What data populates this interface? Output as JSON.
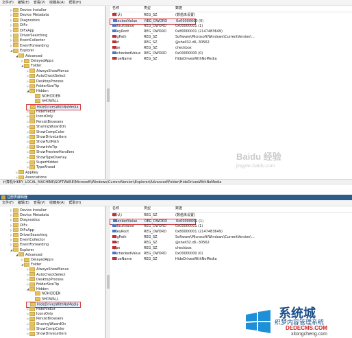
{
  "colors": {
    "highlight_border": "#d23b3b",
    "titlebar": "#2b5c8a",
    "folder": "#e6c25a"
  },
  "panel1": {
    "menu": [
      "文件(F)",
      "编辑(E)",
      "查看(V)",
      "收藏夹(A)",
      "帮助(H)"
    ],
    "tree": [
      {
        "label": "Device Installer",
        "indent": 1,
        "arrow": "▷"
      },
      {
        "label": "Device Metadata",
        "indent": 1,
        "arrow": "▷"
      },
      {
        "label": "Diagnostics",
        "indent": 1,
        "arrow": "▷"
      },
      {
        "label": "DIFx",
        "indent": 1,
        "arrow": "▷"
      },
      {
        "label": "DIFxApp",
        "indent": 1,
        "arrow": "▷"
      },
      {
        "label": "DriverSearching",
        "indent": 1,
        "arrow": "▷"
      },
      {
        "label": "EventCollector",
        "indent": 1,
        "arrow": "▷"
      },
      {
        "label": "EventForwarding",
        "indent": 1,
        "arrow": "▷"
      },
      {
        "label": "Explorer",
        "indent": 1,
        "arrow": "◢"
      },
      {
        "label": "Advanced",
        "indent": 2,
        "arrow": "◢"
      },
      {
        "label": "DelayedApps",
        "indent": 3,
        "arrow": "▷"
      },
      {
        "label": "Folder",
        "indent": 3,
        "arrow": "◢"
      },
      {
        "label": "AlwaysShowMenus",
        "indent": 4,
        "arrow": "▷"
      },
      {
        "label": "AutoCheckSelect",
        "indent": 4,
        "arrow": "▷"
      },
      {
        "label": "DesktopProcess",
        "indent": 4,
        "arrow": "▷"
      },
      {
        "label": "FolderSizeTip",
        "indent": 4,
        "arrow": "▷"
      },
      {
        "label": "Hidden",
        "indent": 4,
        "arrow": "◢"
      },
      {
        "label": "NOHIDDEN",
        "indent": 5,
        "arrow": ""
      },
      {
        "label": "SHOWALL",
        "indent": 5,
        "arrow": ""
      },
      {
        "label": "HideDrivesWithNoMedia",
        "indent": 4,
        "arrow": "",
        "sel": true
      },
      {
        "label": "HideFileExt",
        "indent": 4,
        "arrow": "▷"
      },
      {
        "label": "IconsOnly",
        "indent": 4,
        "arrow": "▷"
      },
      {
        "label": "PersistBrowsers",
        "indent": 4,
        "arrow": "▷"
      },
      {
        "label": "SharingWizardOn",
        "indent": 4,
        "arrow": "▷"
      },
      {
        "label": "ShowCompColor",
        "indent": 4,
        "arrow": "▷"
      },
      {
        "label": "ShowDriveLetters",
        "indent": 4,
        "arrow": "▷"
      },
      {
        "label": "ShowFullPath",
        "indent": 4,
        "arrow": "▷"
      },
      {
        "label": "ShowInfoTip",
        "indent": 4,
        "arrow": "▷"
      },
      {
        "label": "ShowPreviewHandlers",
        "indent": 4,
        "arrow": "▷"
      },
      {
        "label": "ShowTypeOverlay",
        "indent": 4,
        "arrow": "▷"
      },
      {
        "label": "SuperHidden",
        "indent": 4,
        "arrow": "▷"
      },
      {
        "label": "TypeAhead",
        "indent": 4,
        "arrow": "▷"
      },
      {
        "label": "AppKey",
        "indent": 2,
        "arrow": "▷"
      },
      {
        "label": "Associations",
        "indent": 2,
        "arrow": "▷"
      }
    ],
    "columns": {
      "name": "名称",
      "type": "类型",
      "data": "数据"
    },
    "rows": [
      {
        "name": "(默认)",
        "type": "REG_SZ",
        "data": "(数值未设置)",
        "icon": "string"
      },
      {
        "name": "CheckedValue",
        "type": "REG_DWORD",
        "data": "0x00000000 (0)",
        "icon": "binary",
        "sel": true
      },
      {
        "name": "DefaultValue",
        "type": "REG_DWORD",
        "data": "0x00000001 (1)",
        "icon": "binary"
      },
      {
        "name": "HKeyRoot",
        "type": "REG_DWORD",
        "data": "0x80000001 (2147483649)",
        "icon": "binary"
      },
      {
        "name": "RegPath",
        "type": "REG_SZ",
        "data": "Software\\Microsoft\\Windows\\CurrentVersion\\...",
        "icon": "string"
      },
      {
        "name": "Text",
        "type": "REG_SZ",
        "data": "@shell32.dll,-30562",
        "icon": "string"
      },
      {
        "name": "Type",
        "type": "REG_SZ",
        "data": "checkbox",
        "icon": "string"
      },
      {
        "name": "UncheckedValue",
        "type": "REG_DWORD",
        "data": "0x00000000 (0)",
        "icon": "binary"
      },
      {
        "name": "ValueName",
        "type": "REG_SZ",
        "data": "HideDrivesWithNoMedia",
        "icon": "string"
      }
    ],
    "status": "计算机\\HKEY_LOCAL_MACHINE\\SOFTWARE\\Microsoft\\Windows\\CurrentVersion\\Explorer\\Advanced\\Folder\\HideDrivesWithNoMedia",
    "watermark": {
      "logo": "Baidu 经验",
      "url": "jingyan.baidu.com"
    }
  },
  "panel2": {
    "title": "注册表编辑器",
    "menu": [
      "文件(F)",
      "编辑(E)",
      "查看(V)",
      "收藏夹(A)",
      "帮助(H)"
    ],
    "tree": [
      {
        "label": "Device Installer",
        "indent": 1,
        "arrow": "▷"
      },
      {
        "label": "Device Metadata",
        "indent": 1,
        "arrow": "▷"
      },
      {
        "label": "Diagnostics",
        "indent": 1,
        "arrow": "▷"
      },
      {
        "label": "DIFx",
        "indent": 1,
        "arrow": "▷"
      },
      {
        "label": "DIFxApp",
        "indent": 1,
        "arrow": "▷"
      },
      {
        "label": "DriverSearching",
        "indent": 1,
        "arrow": "▷"
      },
      {
        "label": "EventCollector",
        "indent": 1,
        "arrow": "▷"
      },
      {
        "label": "EventForwarding",
        "indent": 1,
        "arrow": "▷"
      },
      {
        "label": "Explorer",
        "indent": 1,
        "arrow": "◢"
      },
      {
        "label": "Advanced",
        "indent": 2,
        "arrow": "◢"
      },
      {
        "label": "DelayedApps",
        "indent": 3,
        "arrow": "▷"
      },
      {
        "label": "Folder",
        "indent": 3,
        "arrow": "◢"
      },
      {
        "label": "AlwaysShowMenus",
        "indent": 4,
        "arrow": "▷"
      },
      {
        "label": "AutoCheckSelect",
        "indent": 4,
        "arrow": "▷"
      },
      {
        "label": "DesktopProcess",
        "indent": 4,
        "arrow": "▷"
      },
      {
        "label": "FolderSizeTip",
        "indent": 4,
        "arrow": "▷"
      },
      {
        "label": "Hidden",
        "indent": 4,
        "arrow": "◢"
      },
      {
        "label": "NOHIDDEN",
        "indent": 5,
        "arrow": ""
      },
      {
        "label": "SHOWALL",
        "indent": 5,
        "arrow": ""
      },
      {
        "label": "HideDrivesWithNoMedia",
        "indent": 4,
        "arrow": "",
        "sel": true
      },
      {
        "label": "HideFileExt",
        "indent": 4,
        "arrow": "▷"
      },
      {
        "label": "IconsOnly",
        "indent": 4,
        "arrow": "▷"
      },
      {
        "label": "PersistBrowsers",
        "indent": 4,
        "arrow": "▷"
      },
      {
        "label": "SharingWizardOn",
        "indent": 4,
        "arrow": "▷"
      },
      {
        "label": "ShowCompColor",
        "indent": 4,
        "arrow": "▷"
      },
      {
        "label": "ShowDriveLetters",
        "indent": 4,
        "arrow": "▷"
      }
    ],
    "columns": {
      "name": "名称",
      "type": "类型",
      "data": "数据"
    },
    "rows": [
      {
        "name": "(默认)",
        "type": "REG_SZ",
        "data": "(数值未设置)",
        "icon": "string"
      },
      {
        "name": "CheckedValue",
        "type": "REG_DWORD",
        "data": "0x00000001 (1)",
        "icon": "binary",
        "sel": true
      },
      {
        "name": "DefaultValue",
        "type": "REG_DWORD",
        "data": "0x00000001 (1)",
        "icon": "binary"
      },
      {
        "name": "HKeyRoot",
        "type": "REG_DWORD",
        "data": "0x80000001 (2147483649)",
        "icon": "binary"
      },
      {
        "name": "RegPath",
        "type": "REG_SZ",
        "data": "Software\\Microsoft\\Windows\\CurrentVersion\\...",
        "icon": "string"
      },
      {
        "name": "Text",
        "type": "REG_SZ",
        "data": "@shell32.dll,-30562",
        "icon": "string"
      },
      {
        "name": "Type",
        "type": "REG_SZ",
        "data": "checkbox",
        "icon": "string"
      },
      {
        "name": "UncheckedValue",
        "type": "REG_DWORD",
        "data": "0x00000000 (0)",
        "icon": "binary"
      },
      {
        "name": "ValueName",
        "type": "REG_SZ",
        "data": "HideDrivesWithNoMedia",
        "icon": "string"
      }
    ],
    "watermark": {
      "big": "系统城",
      "small": "织梦内容管理系统",
      "site": "DEDECMS.COM",
      "site2": "xitongcheng.com"
    }
  }
}
